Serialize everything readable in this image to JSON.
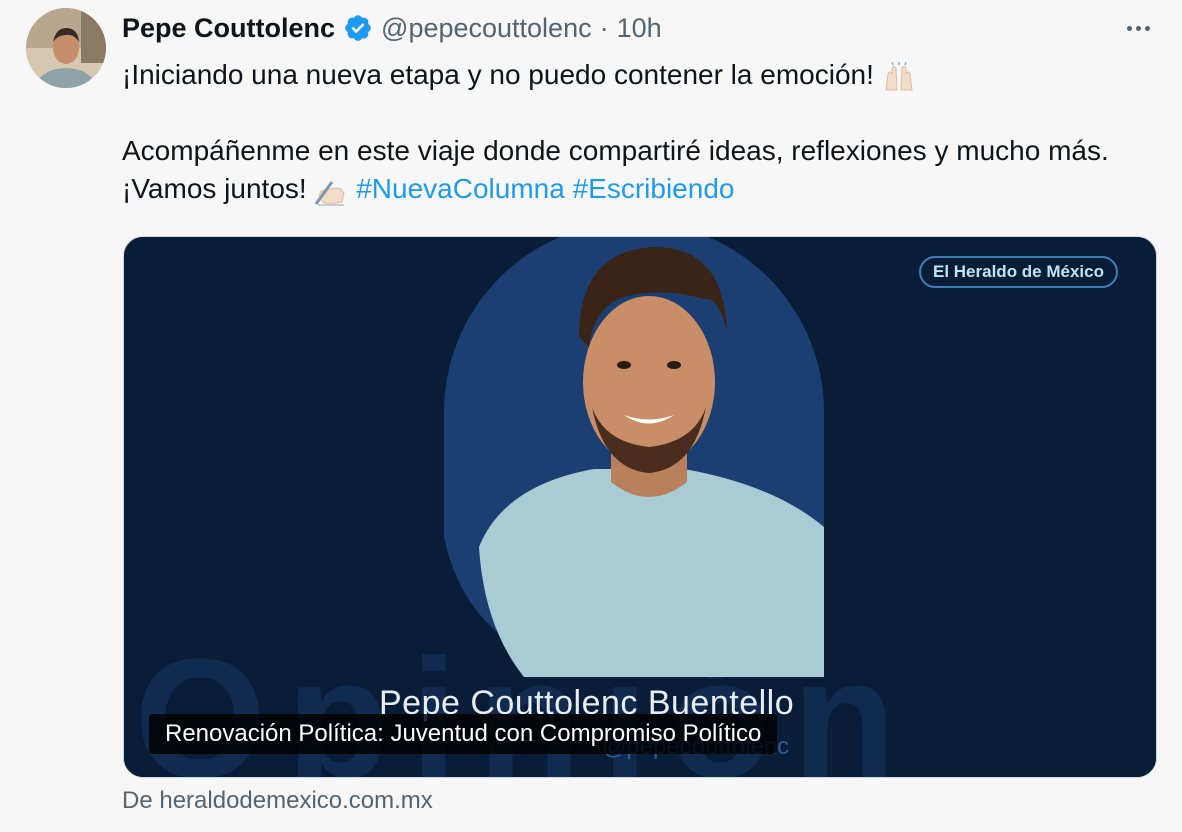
{
  "tweet": {
    "display_name": "Pepe Couttolenc",
    "handle": "@pepecouttolenc",
    "separator": "·",
    "time": "10h",
    "line1": "¡Iniciando una nueva etapa y no puedo contener la emoción!",
    "line2": "Acompáñenme en este viaje donde compartiré ideas, reflexiones y mucho más. ¡Vamos juntos!",
    "hashtags": [
      "#NuevaColumna",
      "#Escribiendo"
    ]
  },
  "card": {
    "brand": "El Heraldo de México",
    "background_word": "Opinión",
    "author": "Pepe Couttolenc Buentello",
    "author_handle": "@pepecouttolenc",
    "title": "Renovación Política: Juventud con Compromiso Político"
  },
  "source": "De heraldodemexico.com.mx",
  "icons": [
    "avatar",
    "verified-badge-icon",
    "more-icon",
    "raised-hands-emoji",
    "writing-hand-emoji"
  ],
  "colors": {
    "link": "#1d9bf0",
    "verified": "#1d9bf0",
    "card_bg": "#0a1d38",
    "muted": "#536471"
  }
}
